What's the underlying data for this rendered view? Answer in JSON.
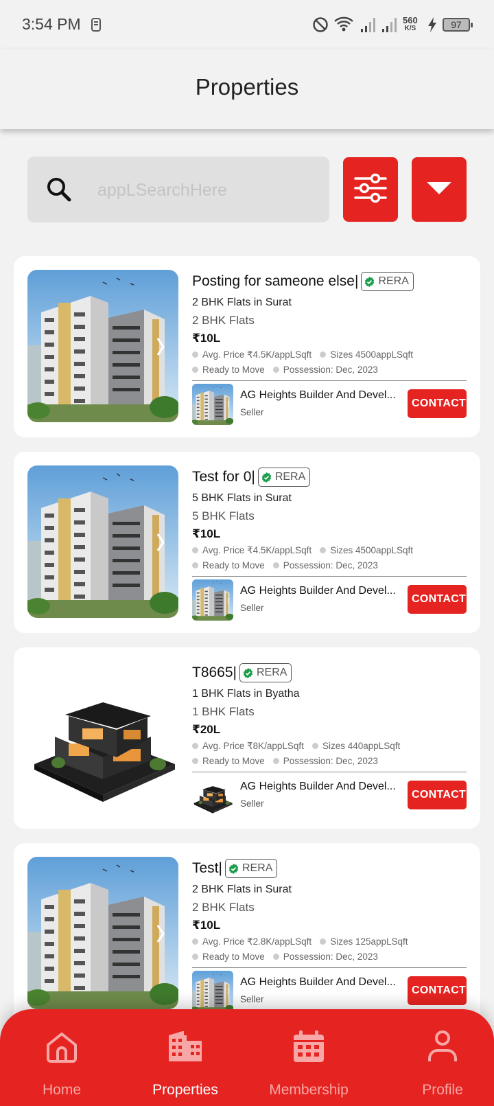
{
  "status_bar": {
    "time": "3:54 PM",
    "speed_value": "560",
    "speed_unit": "K/S",
    "battery": "97"
  },
  "app_bar": {
    "title": "Properties"
  },
  "search": {
    "placeholder": "appLSearchHere",
    "value": ""
  },
  "toolbar": {
    "filter_icon": "sliders-icon",
    "sort_icon": "dropdown-triangle-icon"
  },
  "colors": {
    "accent": "#e52421",
    "rera_check": "#1a9e4b",
    "background": "#f2f2f2"
  },
  "properties": [
    {
      "title": "Posting for sameone else|",
      "rera": "RERA",
      "subtitle": "2 BHK Flats in Surat",
      "type": "2 BHK Flats",
      "price": "₹10L",
      "avg_price": "Avg. Price ₹4.5K/appLSqft",
      "sizes": "Sizes 4500appLSqft",
      "status": "Ready to Move",
      "possession": "Possession: Dec, 2023",
      "seller_name": "AG Heights Builder And Devel...",
      "seller_role": "Seller",
      "contact": "CONTACT",
      "image": "apartment-tower"
    },
    {
      "title": "Test for 0|",
      "rera": "RERA",
      "subtitle": "5 BHK Flats in Surat",
      "type": "5 BHK Flats",
      "price": "₹10L",
      "avg_price": "Avg. Price ₹4.5K/appLSqft",
      "sizes": "Sizes 4500appLSqft",
      "status": "Ready to Move",
      "possession": "Possession: Dec, 2023",
      "seller_name": "AG Heights Builder And Devel...",
      "seller_role": "Seller",
      "contact": "CONTACT",
      "image": "apartment-tower"
    },
    {
      "title": "T8665|",
      "rera": "RERA",
      "subtitle": "1 BHK Flats in Byatha",
      "type": "1 BHK Flats",
      "price": "₹20L",
      "avg_price": "Avg. Price ₹8K/appLSqft",
      "sizes": "Sizes 440appLSqft",
      "status": "Ready to Move",
      "possession": "Possession: Dec, 2023",
      "seller_name": "AG Heights Builder And Devel...",
      "seller_role": "Seller",
      "contact": "CONTACT",
      "image": "modern-house"
    },
    {
      "title": "Test|",
      "rera": "RERA",
      "subtitle": "2 BHK Flats in Surat",
      "type": "2 BHK Flats",
      "price": "₹10L",
      "avg_price": "Avg. Price ₹2.8K/appLSqft",
      "sizes": "Sizes 125appLSqft",
      "status": "Ready to Move",
      "possession": "Possession: Dec, 2023",
      "seller_name": "AG Heights Builder And Devel...",
      "seller_role": "Seller",
      "contact": "CONTACT",
      "image": "apartment-tower"
    }
  ],
  "bottom_nav": [
    {
      "label": "Home",
      "icon": "home-icon",
      "active": false
    },
    {
      "label": "Properties",
      "icon": "building-icon",
      "active": true
    },
    {
      "label": "Membership",
      "icon": "calendar-icon",
      "active": false
    },
    {
      "label": "Profile",
      "icon": "person-icon",
      "active": false
    }
  ]
}
